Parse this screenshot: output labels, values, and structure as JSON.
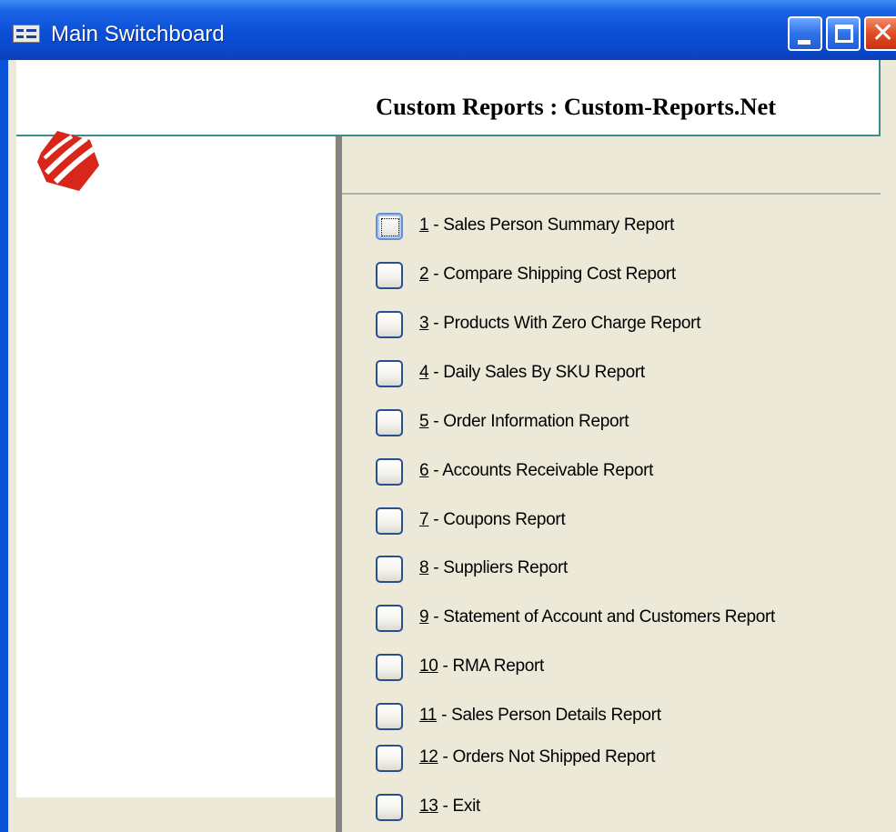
{
  "window": {
    "title": "Main Switchboard",
    "accent": "#0a52d8",
    "close_color": "#e04c24",
    "buttons": [
      "minimize",
      "maximize",
      "close"
    ]
  },
  "logo": {
    "name": "company-logo-icon",
    "color": "#d8261a"
  },
  "panel": {
    "title": "Custom Reports : Custom-Reports.Net",
    "background": "#ece9d8"
  },
  "menu": {
    "items": [
      {
        "num": "1",
        "label": " - Sales Person Summary Report",
        "focused": true
      },
      {
        "num": "2",
        "label": " - Compare Shipping Cost Report"
      },
      {
        "num": "3",
        "label": " - Products With Zero Charge Report"
      },
      {
        "num": "4",
        "label": " - Daily Sales By SKU Report"
      },
      {
        "num": "5",
        "label": " - Order Information Report"
      },
      {
        "num": "6",
        "label": " - Accounts Receivable Report"
      },
      {
        "num": "7",
        "label": " - Coupons Report"
      },
      {
        "num": "8",
        "label": " - Suppliers Report"
      },
      {
        "num": "9",
        "label": " - Statement of Account and Customers Report"
      },
      {
        "num": "10",
        "label": " - RMA Report"
      },
      {
        "num": "11",
        "label": " - Sales Person Details Report"
      },
      {
        "num": "12",
        "label": " - Orders Not Shipped Report"
      },
      {
        "num": "13",
        "label": " - Exit"
      }
    ]
  }
}
